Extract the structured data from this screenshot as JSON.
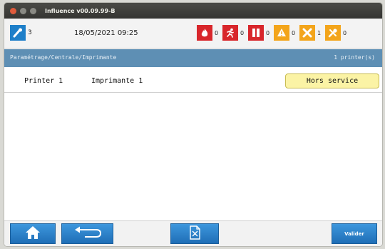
{
  "window": {
    "title": "Influence v00.09.99-B"
  },
  "status": {
    "user_count": "3",
    "datetime": "18/05/2021 09:25",
    "counters": [
      {
        "icon": "fire-alarm-icon",
        "value": "0",
        "color": "#d8262b"
      },
      {
        "icon": "evacuation-icon",
        "value": "0",
        "color": "#d8262b"
      },
      {
        "icon": "door-icon",
        "value": "0",
        "color": "#d8262b"
      },
      {
        "icon": "warning-icon",
        "value": "0",
        "color": "#f3a51b"
      },
      {
        "icon": "fault-icon",
        "value": "1",
        "color": "#f3a51b"
      },
      {
        "icon": "maintenance-icon",
        "value": "0",
        "color": "#f3a51b"
      }
    ]
  },
  "breadcrumb": {
    "path": "Paramétrage/Centrale/Imprimante",
    "count": "1 printer(s)"
  },
  "printers": [
    {
      "name": "Printer 1",
      "label": "Imprimante 1",
      "status": "Hors service"
    }
  ],
  "footer": {
    "valider_label": "Valider"
  },
  "colors": {
    "accent_blue": "#1f6eb6",
    "crumb_bar": "#5e8fb4",
    "status_yellow": "#fbf3a5"
  }
}
